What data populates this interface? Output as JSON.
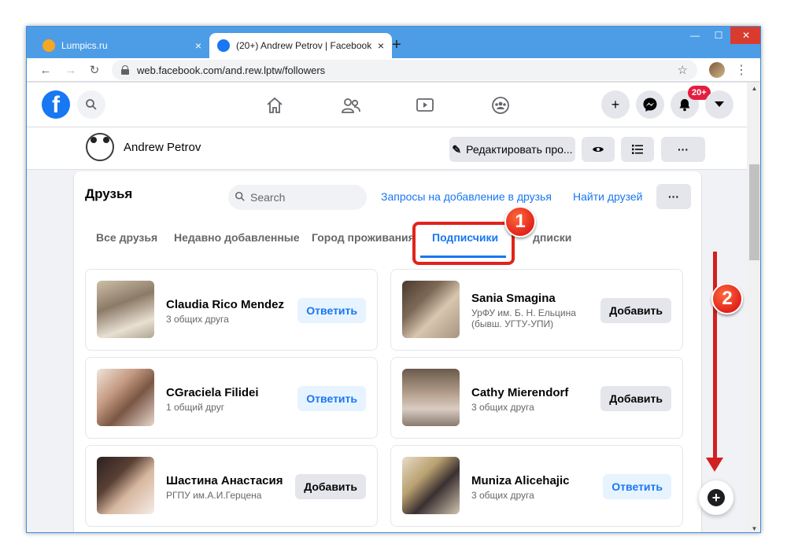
{
  "browser": {
    "tabs": [
      {
        "title": "Lumpics.ru",
        "active": false
      },
      {
        "title": "(20+) Andrew Petrov | Facebook",
        "active": true
      }
    ],
    "new_tab": "+",
    "url": "web.facebook.com/and.rew.lptw/followers",
    "win_min": "—",
    "win_max": "☐",
    "win_close": "✕",
    "close_glyph": "×"
  },
  "fb_nav": {
    "logo": "f",
    "notifications_badge": "20+"
  },
  "profile": {
    "name": "Andrew Petrov",
    "edit_button": "Редактировать про..."
  },
  "friends": {
    "title": "Друзья",
    "search_placeholder": "Search",
    "requests_link": "Запросы на добавление в друзья",
    "find_link": "Найти друзей",
    "tabs": [
      "Все друзья",
      "Недавно добавленные",
      "Город проживания",
      "Подписчики",
      "дписки"
    ],
    "active_tab": 3,
    "list": [
      {
        "name": "Claudia Rico Mendez",
        "sub": "3 общих друга",
        "action": "Ответить",
        "type": "reply"
      },
      {
        "name": "Sania Smagina",
        "sub": "УрФУ им. Б. Н. Ельцина (бывш. УГТУ-УПИ)",
        "action": "Добавить",
        "type": "add"
      },
      {
        "name": "CGraciela Filidei",
        "sub": "1 общий друг",
        "action": "Ответить",
        "type": "reply"
      },
      {
        "name": "Cathy Mierendorf",
        "sub": "3 общих друга",
        "action": "Добавить",
        "type": "add"
      },
      {
        "name": "Шастина Анастасия",
        "sub": "РГПУ им.А.И.Герцена",
        "action": "Добавить",
        "type": "add"
      },
      {
        "name": "Muniza Alicehajic",
        "sub": "3 общих друга",
        "action": "Ответить",
        "type": "reply"
      }
    ]
  },
  "annotations": {
    "step1": "1",
    "step2": "2"
  },
  "colors": {
    "brand": "#1877f2",
    "annotation_red": "#e2231a",
    "chrome_blue": "#4c9de6"
  }
}
